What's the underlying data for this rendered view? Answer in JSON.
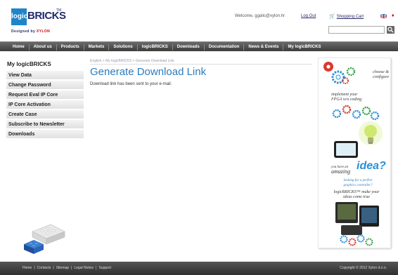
{
  "header": {
    "logo": {
      "box_text": "logic",
      "word": "BRICKS",
      "tm": "TM",
      "tagline_prefix": "Designed by ",
      "tagline_brand": "XYLON"
    },
    "welcome": "Welcome, ggalic@xylon.hr",
    "logout": "Log Out",
    "cart": "Shopping Cart",
    "search_placeholder": ""
  },
  "nav": {
    "items": [
      "Home",
      "About us",
      "Products",
      "Markets",
      "Solutions",
      "logicBRICKS",
      "Downloads",
      "Documentation",
      "News & Events",
      "My logicBRICKS"
    ]
  },
  "sidebar": {
    "title": "My logicBRICKS",
    "items": [
      "View Data",
      "Change Password",
      "Request Eval IP Core",
      "IP Core Activation",
      "Create Case",
      "Subscribe to Newsletter",
      "Downloads"
    ]
  },
  "main": {
    "breadcrumb": "English > My logicBRICKS > Generate Download Link",
    "title": "Generate Download Link",
    "message": "Download link has been sent to your e-mail."
  },
  "banner": {
    "choose_line1": "choose &",
    "choose_line2": "configure",
    "implement_line1": "implement your",
    "implement_line2": "FPGA w/o coding",
    "have_line": "you have an",
    "amazing": "amazing",
    "idea": "idea?",
    "looking_line1": "looking for a perfect",
    "looking_line2": "graphics controller?",
    "make_line1": "logicBRICKS™ make your",
    "make_line2": "ideas come true"
  },
  "footer": {
    "links": [
      "Home",
      "Contacts",
      "Sitemap",
      "Legal Notice",
      "Support"
    ],
    "copyright": "Copyright © 2012 Xylon d.o.o."
  },
  "colors": {
    "accent": "#2a7cc0",
    "nav_bg": "#4a4a4a",
    "brand_dark": "#1e2a6e",
    "gear_red": "#d83a2e",
    "gear_blue": "#2a8fd6",
    "gear_green": "#3da04a"
  }
}
